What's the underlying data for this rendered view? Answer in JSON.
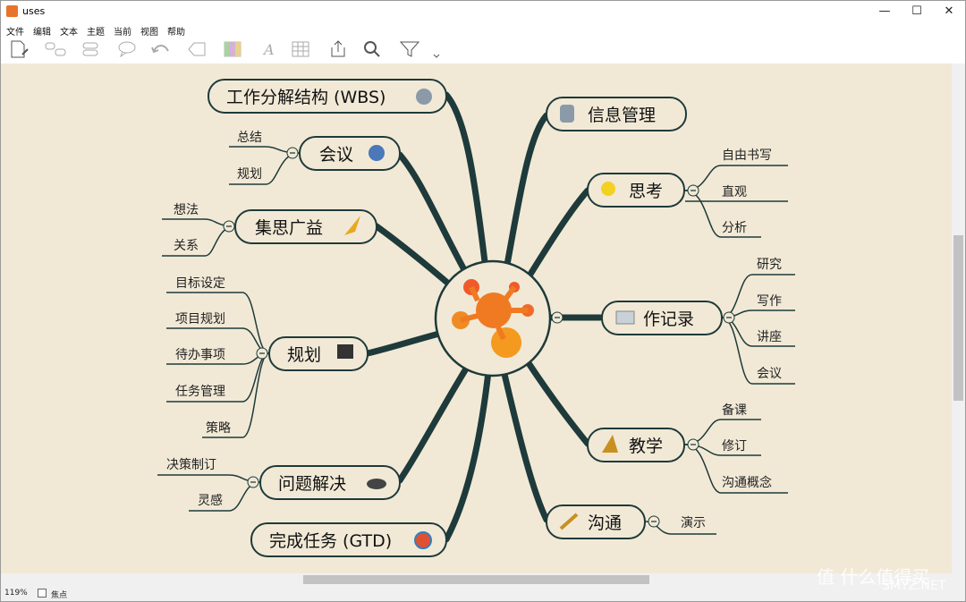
{
  "window": {
    "title": "uses",
    "minimize": "—",
    "maximize": "☐",
    "close": "✕"
  },
  "menu": [
    "文件",
    "编辑",
    "文本",
    "主题",
    "当前",
    "视图",
    "帮助"
  ],
  "toolbar": [
    "new-note-icon",
    "link-topics-icon",
    "group-icon",
    "callout-icon",
    "undo-icon",
    "boundary-icon",
    "color-icon",
    "font-icon",
    "table-icon",
    "export-icon",
    "search-icon",
    "filter-icon"
  ],
  "map": {
    "topics": {
      "wbs": "工作分解结构 (WBS)",
      "info": "信息管理",
      "meeting": "会议",
      "think": "思考",
      "brainstorm": "集思广益",
      "record": "作记录",
      "plan": "规划",
      "teach": "教学",
      "problem": "问题解决",
      "gtd": "完成任务 (GTD)",
      "communicate": "沟通"
    },
    "sub": {
      "meeting": [
        "总结",
        "规划"
      ],
      "think": [
        "自由书写",
        "直观",
        "分析"
      ],
      "brainstorm": [
        "想法",
        "关系"
      ],
      "record": [
        "研究",
        "写作",
        "讲座",
        "会议"
      ],
      "plan": [
        "目标设定",
        "项目规划",
        "待办事项",
        "任务管理",
        "策略"
      ],
      "teach": [
        "备课",
        "修订",
        "沟通概念"
      ],
      "problem": [
        "决策制订",
        "灵感"
      ],
      "communicate": [
        "演示"
      ]
    }
  },
  "status": {
    "zoom": "119%",
    "focus": "焦点"
  },
  "watermark": {
    "text": "值 什么值得买",
    "site": "SMYZ.NET"
  },
  "colors": {
    "canvas": "#f1e9d6",
    "branch": "#1e3a3a",
    "center_orange": "#f07a22"
  }
}
